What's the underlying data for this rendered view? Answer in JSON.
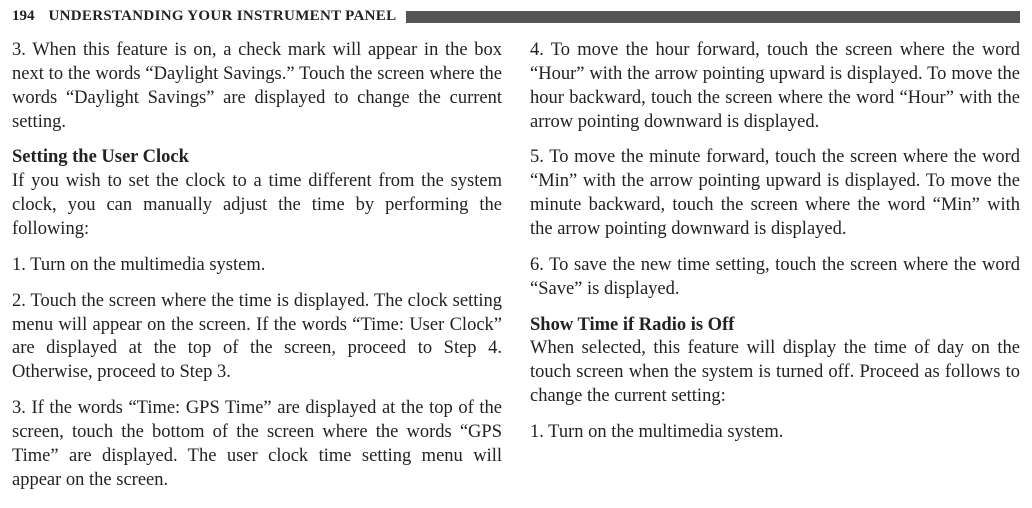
{
  "header": {
    "page_number": "194",
    "chapter_title": "UNDERSTANDING YOUR INSTRUMENT PANEL"
  },
  "left": {
    "p1": "3. When this feature is on, a check mark will appear in the box next to the words “Daylight Savings.” Touch the screen where the words “Daylight Savings” are displayed to change the current setting.",
    "h1": "Setting the User Clock",
    "p2": "If you wish to set the clock to a time different from the system clock, you can manually adjust the time by performing the following:",
    "p3": "1. Turn on the multimedia system.",
    "p4": "2. Touch the screen where the time is displayed. The clock setting menu will appear on the screen. If the words “Time: User Clock” are displayed at the top of the screen, proceed to Step 4. Otherwise, proceed to Step 3.",
    "p5": "3. If the words “Time: GPS Time” are displayed at the top of the screen, touch the bottom of the screen where the words “GPS Time” are displayed. The user clock time setting menu will appear on the screen."
  },
  "right": {
    "p1": "4. To move the hour forward, touch the screen where the word “Hour” with the arrow pointing upward is displayed. To move the hour backward, touch the screen where the word “Hour” with the arrow pointing downward is displayed.",
    "p2": "5. To move the minute forward, touch the screen where the word “Min” with the arrow pointing upward is displayed. To move the minute backward, touch the screen where the word “Min” with the arrow pointing downward is displayed.",
    "p3": "6. To save the new time setting, touch the screen where the word “Save” is displayed.",
    "h1": "Show Time if Radio is Off",
    "p4": "When selected, this feature will display the time of day on the touch screen when the system is turned off. Proceed as follows to change the current setting:",
    "p5": "1. Turn on the multimedia system."
  }
}
